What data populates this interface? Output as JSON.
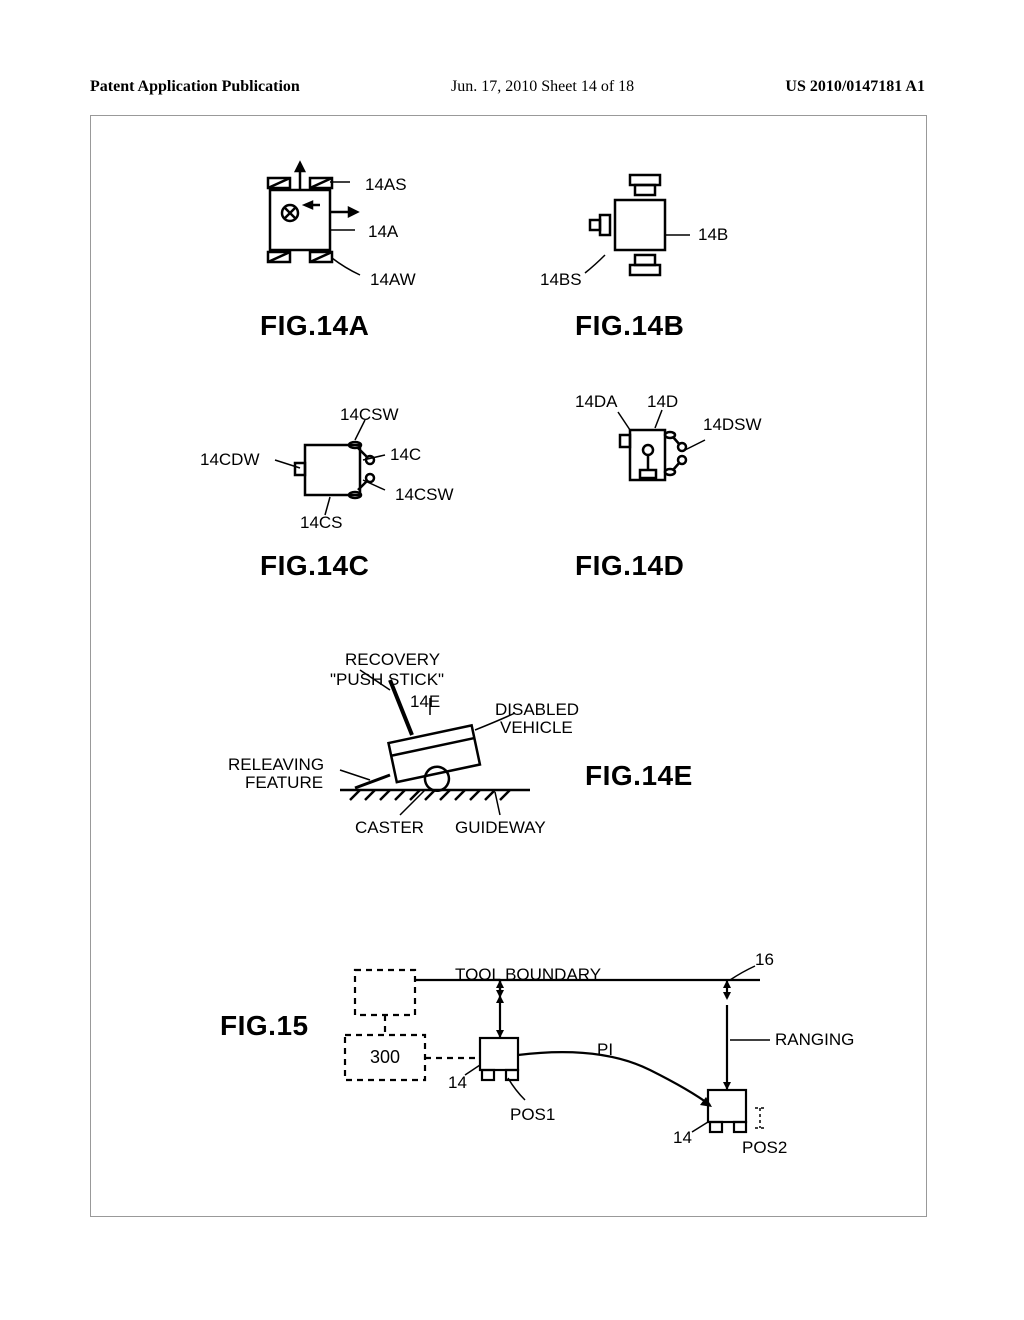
{
  "header": {
    "left": "Patent Application Publication",
    "center": "Jun. 17, 2010  Sheet 14 of 18",
    "right": "US 2010/0147181 A1"
  },
  "figA": {
    "title": "FIG.14A",
    "labels": {
      "as": "14AS",
      "a": "14A",
      "aw": "14AW"
    }
  },
  "figB": {
    "title": "FIG.14B",
    "labels": {
      "b": "14B",
      "bs": "14BS"
    }
  },
  "figC": {
    "title": "FIG.14C",
    "labels": {
      "cdw": "14CDW",
      "csw1": "14CSW",
      "c": "14C",
      "csw2": "14CSW",
      "cs": "14CS"
    }
  },
  "figD": {
    "title": "FIG.14D",
    "labels": {
      "da": "14DA",
      "d": "14D",
      "dsw": "14DSW"
    }
  },
  "figE": {
    "title": "FIG.14E",
    "labels": {
      "recovery": "RECOVERY",
      "push": "\"PUSH STICK\"",
      "e": "14E",
      "disabled": "DISABLED",
      "vehicle": "VEHICLE",
      "releaving": "RELEAVING",
      "feature": "FEATURE",
      "caster": "CASTER",
      "guideway": "GUIDEWAY"
    }
  },
  "fig15": {
    "title": "FIG.15",
    "labels": {
      "tool": "TOOL BOUNDARY",
      "sixteen": "16",
      "ranging": "RANGING",
      "300": "300",
      "pi": "PI",
      "fourteen1": "14",
      "pos1": "POS1",
      "fourteen2": "14",
      "pos2": "POS2"
    }
  }
}
